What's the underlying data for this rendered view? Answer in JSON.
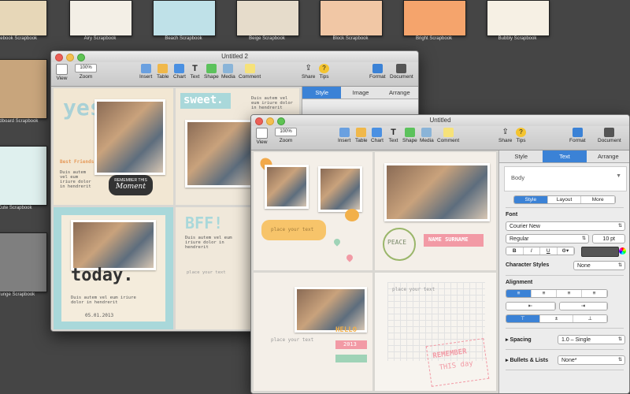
{
  "chooser": {
    "templates": [
      {
        "label": "Notebook Scrapbook",
        "color": "#e7d7b8"
      },
      {
        "label": "Airy Scrapbook",
        "color": "#f3efe6"
      },
      {
        "label": "Beach Scrapbook",
        "color": "#bfe1e8"
      },
      {
        "label": "Beige Scrapbook",
        "color": "#e6dccb"
      },
      {
        "label": "Block Scrapbook",
        "color": "#f1c7a5"
      },
      {
        "label": "Bright Scrapbook",
        "color": "#f5a46c"
      },
      {
        "label": "Bubbly Scrapbook",
        "color": "#f6f0e4"
      },
      {
        "label": "Cardboard Scrapbook",
        "color": "#c8a57c"
      },
      {
        "label": "Cute Scrapbook",
        "color": "#dff0ee"
      },
      {
        "label": "Grunge Scrapbook",
        "color": "#7f7f7f"
      }
    ]
  },
  "win_back": {
    "title": "Untitled 2",
    "zoom": "100%",
    "toolbar": {
      "view": "View",
      "zoom": "Zoom",
      "insert": "Insert",
      "table": "Table",
      "chart": "Chart",
      "text": "Text",
      "shape": "Shape",
      "media": "Media",
      "comment": "Comment",
      "share": "Share",
      "tips": "Tips",
      "format": "Format",
      "document": "Document"
    },
    "tabs": {
      "style": "Style",
      "image": "Image",
      "arrange": "Arrange"
    },
    "page1": {
      "big": "yes.",
      "badge1": "REMEMBER THIS",
      "badge2": "Moment",
      "friend": "Best Friends",
      "lorem": "Duis autem vel eum iriure dolor in hendrerit"
    },
    "page2": {
      "big": "sweet.",
      "lorem": "Duis autem vel eum iriure dolor in hendrerit"
    },
    "page3": {
      "big": "today.",
      "lorem": "Duis autem vel eum iriure dolor in hendrerit",
      "date": "05.01.2013"
    },
    "page4": {
      "big": "BFF!",
      "lorem": "Duis autem vel eum iriure dolor in hendrerit",
      "placeholder": "place your text"
    }
  },
  "win_front": {
    "title": "Untitled",
    "zoom": "100%",
    "toolbar": {
      "view": "View",
      "zoom": "Zoom",
      "insert": "Insert",
      "table": "Table",
      "chart": "Chart",
      "text": "Text",
      "shape": "Shape",
      "media": "Media",
      "comment": "Comment",
      "share": "Share",
      "tips": "Tips",
      "format": "Format",
      "document": "Document"
    },
    "tabs": {
      "style": "Style",
      "text": "Text",
      "arrange": "Arrange"
    },
    "paragraph_style": "Body",
    "subtabs": {
      "style": "Style",
      "layout": "Layout",
      "more": "More"
    },
    "font": {
      "heading": "Font",
      "family": "Courier New",
      "weight": "Regular",
      "size": "10 pt"
    },
    "format_buttons": {
      "bold": "B",
      "italic": "I",
      "underline": "U",
      "gear": "⚙▾"
    },
    "char_styles": {
      "label": "Character Styles",
      "value": "None"
    },
    "alignment": {
      "heading": "Alignment"
    },
    "spacing": {
      "label": "Spacing",
      "value": "1.0 – Single"
    },
    "bullets": {
      "label": "Bullets & Lists",
      "value": "None*"
    },
    "pages": {
      "placeholder1": "place your text",
      "peace": "PEACE",
      "name": "NAME SURNAME",
      "placeholder2": "place your text",
      "placeholder3": "place your text",
      "hello": "HELLO",
      "year": "2013",
      "remember1": "REMEMBER",
      "remember2": "THIS day"
    }
  }
}
